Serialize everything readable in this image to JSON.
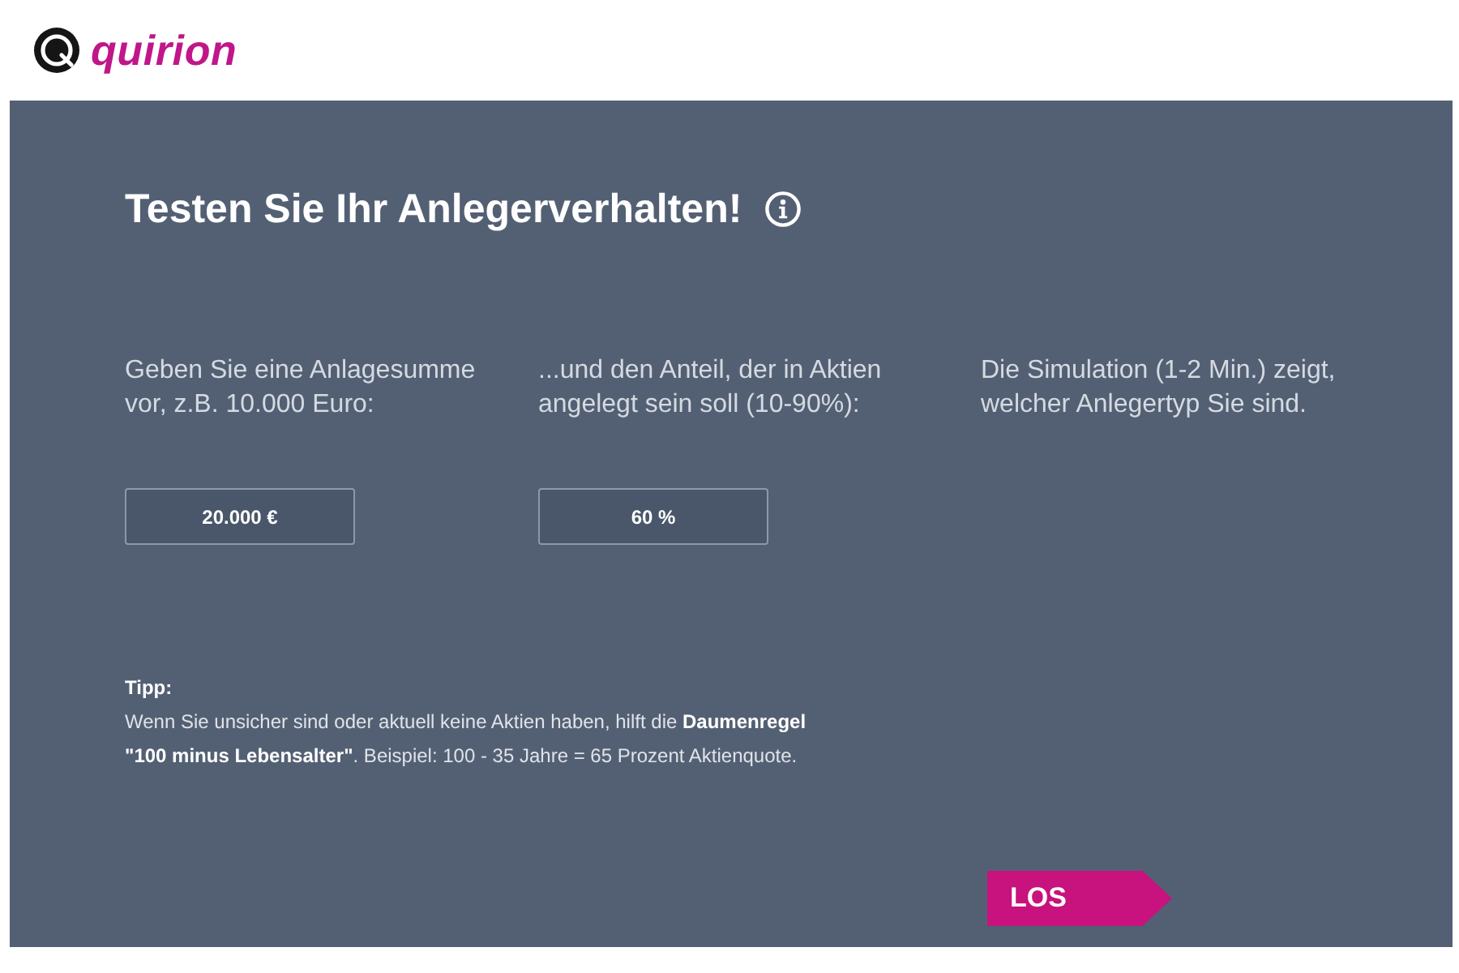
{
  "header": {
    "logo_text": "quirion"
  },
  "panel": {
    "title": "Testen Sie Ihr Anlegerverhalten!",
    "steps": [
      {
        "kind": "input",
        "label": "Geben Sie eine Anlagesumme vor, z.B. 10.000 Euro:",
        "value": "20.000 €"
      },
      {
        "kind": "input",
        "label": "...und den Anteil, der in Aktien angelegt sein soll (10-90%):",
        "value": "60 %"
      },
      {
        "kind": "text",
        "label": "Die Simulation (1-2 Min.) zeigt, welcher Anlegertyp Sie sind."
      }
    ],
    "tip": {
      "heading": "Tipp:",
      "text": "Wenn Sie unsicher sind oder aktuell keine Aktien haben, hilft die **Daumenregel \"100 minus Lebensalter\"**. Beispiel: 100 - 35 Jahre = 65 Prozent Aktienquote."
    },
    "button": "LOS"
  }
}
